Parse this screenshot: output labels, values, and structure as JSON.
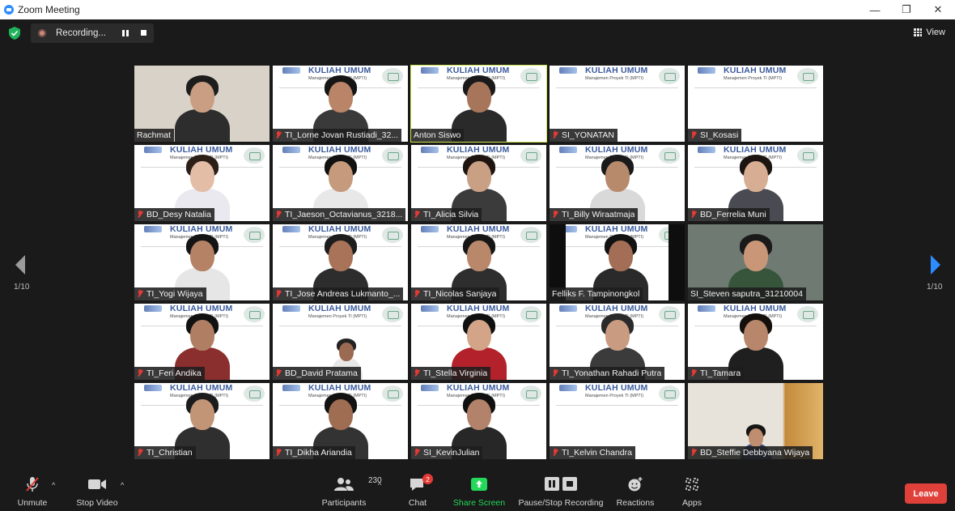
{
  "window": {
    "title": "Zoom Meeting",
    "controls": [
      "—",
      "❐",
      "✕"
    ]
  },
  "recording": {
    "label": "Recording..."
  },
  "view_button": {
    "label": "View"
  },
  "pagination": {
    "left": "1/10",
    "right": "1/10"
  },
  "participants": [
    {
      "name": "Rachmat",
      "muted": false,
      "slide": false,
      "active": false
    },
    {
      "name": "TI_Lorne Jovan Rustiadi_32...",
      "muted": true,
      "slide": true,
      "active": false
    },
    {
      "name": "Anton Siswo",
      "muted": false,
      "slide": true,
      "active": true
    },
    {
      "name": "SI_YONATAN",
      "muted": true,
      "slide": true,
      "active": false
    },
    {
      "name": "SI_Kosasi",
      "muted": true,
      "slide": true,
      "active": false
    },
    {
      "name": "BD_Desy Natalia",
      "muted": true,
      "slide": true,
      "active": false
    },
    {
      "name": "TI_Jaeson_Octavianus_3218...",
      "muted": true,
      "slide": true,
      "active": false
    },
    {
      "name": "TI_Alicia Silvia",
      "muted": true,
      "slide": true,
      "active": false
    },
    {
      "name": "TI_Billy Wiraatmaja",
      "muted": true,
      "slide": true,
      "active": false
    },
    {
      "name": "BD_Ferrelia Muni",
      "muted": true,
      "slide": true,
      "active": false
    },
    {
      "name": "TI_Yogi Wijaya",
      "muted": true,
      "slide": true,
      "active": false
    },
    {
      "name": "TI_Jose Andreas Lukmanto_...",
      "muted": true,
      "slide": true,
      "active": false
    },
    {
      "name": "TI_Nicolas Sanjaya",
      "muted": true,
      "slide": true,
      "active": false
    },
    {
      "name": "Felliks F. Tampinongkol",
      "muted": false,
      "slide": true,
      "active": false
    },
    {
      "name": "SI_Steven saputra_31210004",
      "muted": false,
      "slide": false,
      "active": false
    },
    {
      "name": "TI_Feri Andika",
      "muted": true,
      "slide": true,
      "active": false
    },
    {
      "name": "BD_David Pratama",
      "muted": true,
      "slide": true,
      "active": false
    },
    {
      "name": "TI_Stella Virginia",
      "muted": true,
      "slide": true,
      "active": false
    },
    {
      "name": "TI_Yonathan Rahadi Putra",
      "muted": true,
      "slide": true,
      "active": false
    },
    {
      "name": "TI_Tamara",
      "muted": true,
      "slide": true,
      "active": false
    },
    {
      "name": "TI_Christian",
      "muted": true,
      "slide": true,
      "active": false
    },
    {
      "name": "TI_Dikha Ariandia",
      "muted": true,
      "slide": true,
      "active": false
    },
    {
      "name": "SI_KevinJulian",
      "muted": true,
      "slide": true,
      "active": false
    },
    {
      "name": "TI_Kelvin Chandra",
      "muted": true,
      "slide": true,
      "active": false
    },
    {
      "name": "BD_Steffie Debbyana Wijaya",
      "muted": true,
      "slide": false,
      "active": false
    }
  ],
  "slide_text": {
    "heading": "KULIAH UMUM",
    "subheading": "Manajemen Proyek TI (MPTI)"
  },
  "toolbar": {
    "unmute": "Unmute",
    "stop_video": "Stop Video",
    "participants": "Participants",
    "participants_count": "230",
    "chat": "Chat",
    "chat_badge": "2",
    "share_screen": "Share Screen",
    "pause_stop_recording": "Pause/Stop Recording",
    "reactions": "Reactions",
    "apps": "Apps",
    "leave": "Leave"
  },
  "colors": {
    "share_green": "#23d959",
    "leave_red": "#e0403a",
    "active_border": "#c9e34a",
    "muted_red": "#e53935",
    "nav_blue": "#2d8cff"
  }
}
